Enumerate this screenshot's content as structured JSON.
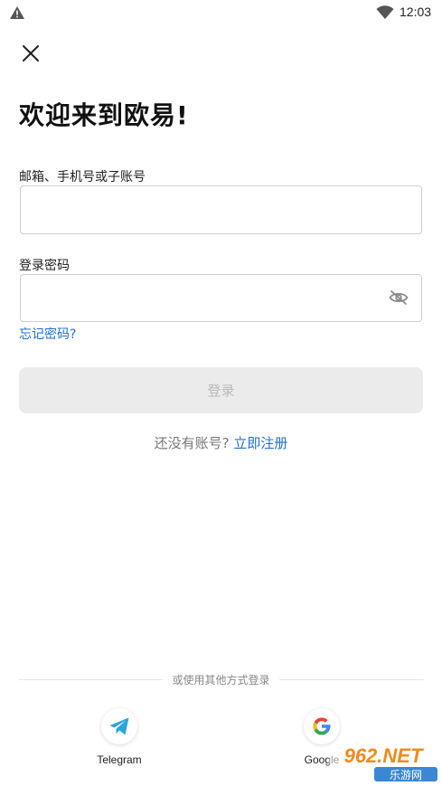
{
  "status_bar": {
    "time": "12:03"
  },
  "header": {
    "close_icon": "close-icon"
  },
  "title": "欢迎来到欧易!",
  "form": {
    "email_label": "邮箱、手机号或子账号",
    "email_value": "",
    "password_label": "登录密码",
    "password_value": "",
    "forgot_password": "忘记密码?",
    "login_button": "登录"
  },
  "signup": {
    "question": "还没有账号?",
    "link": "立即注册"
  },
  "other_login": {
    "divider_text": "或使用其他方式登录",
    "options": [
      {
        "label": "Telegram",
        "icon": "telegram-icon"
      },
      {
        "label": "Google",
        "icon": "google-icon"
      }
    ]
  },
  "watermark": {
    "text": "962.NET",
    "sub": "乐游网"
  },
  "colors": {
    "link": "#1e6fd8",
    "button_disabled_bg": "#ebebeb",
    "telegram": "#2aa3e0"
  }
}
